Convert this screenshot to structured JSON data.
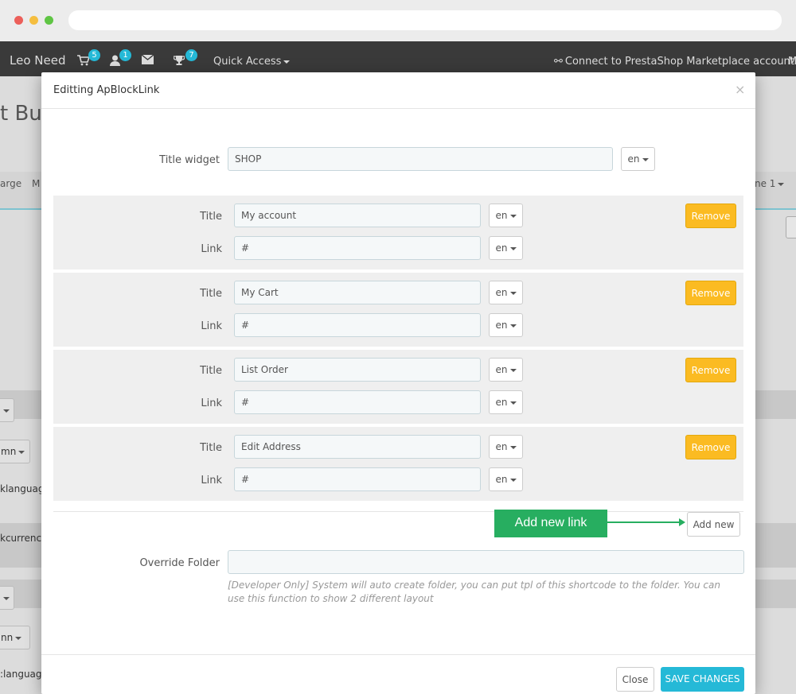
{
  "topnav": {
    "brand": "Leo Need",
    "cart_badge": "5",
    "customers_badge": "1",
    "trophy_badge": "7",
    "quick_access": "Quick Access",
    "connect": "Connect to PrestaShop Marketplace account",
    "more": "M"
  },
  "background": {
    "title": "t Bui",
    "toolbar_left": "arge",
    "toolbar_left2": "M",
    "toolbar_right": "ne 1",
    "frag_language1": "klanguag",
    "frag_currency": "kcurrenc",
    "frag_language2": ":languag",
    "select_column": "mn",
    "select_column2": "nn"
  },
  "modal": {
    "title": "Editting ApBlockLink",
    "close_symbol": "×",
    "title_widget_label": "Title widget",
    "title_widget_value": "SHOP",
    "lang": "en",
    "links": [
      {
        "title_label": "Title",
        "title_value": "My account",
        "link_label": "Link",
        "link_value": "#",
        "remove": "Remove"
      },
      {
        "title_label": "Title",
        "title_value": "My Cart",
        "link_label": "Link",
        "link_value": "#",
        "remove": "Remove"
      },
      {
        "title_label": "Title",
        "title_value": "List Order",
        "link_label": "Link",
        "link_value": "#",
        "remove": "Remove"
      },
      {
        "title_label": "Title",
        "title_value": "Edit Address",
        "link_label": "Link",
        "link_value": "#",
        "remove": "Remove"
      }
    ],
    "annotation": "Add new link",
    "add_new": "Add new",
    "override_label": "Override Folder",
    "override_value": "",
    "help_text": "[Developer Only] System will auto create folder, you can put tpl of this shortcode to the folder. You can use this function to show 2 different layout",
    "close_button": "Close",
    "save_button": "SAVE CHANGES"
  },
  "colors": {
    "primary": "#25b9d7",
    "warning": "#fbbb22",
    "annotation": "#27ae60",
    "nav_bg": "#3a3a3a"
  }
}
